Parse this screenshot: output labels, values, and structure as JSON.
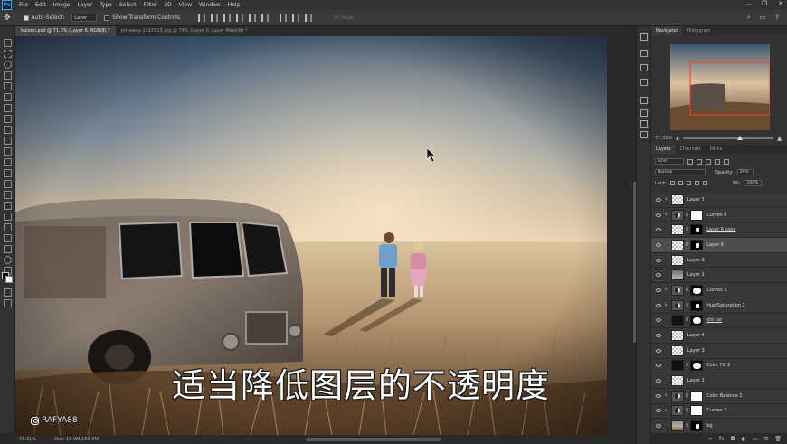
{
  "menubar": {
    "app_icon": "Ps",
    "items": [
      "File",
      "Edit",
      "Image",
      "Layer",
      "Type",
      "Select",
      "Filter",
      "3D",
      "View",
      "Window",
      "Help"
    ]
  },
  "options": {
    "auto_select_label": "Auto-Select:",
    "auto_select_value": "Layer",
    "transform_label": "Show Transform Controls",
    "mode_3d": "3D Mode:"
  },
  "tabs": [
    {
      "label": "baloon.psd @ 71.3% (Layer 6, RGB/8) *",
      "active": true
    },
    {
      "label": "pic-away-1315515.jpg @ 76% (Layer 0, Layer Mask/8) *",
      "active": false
    }
  ],
  "canvas": {
    "subtitle": "适当降低图层的不透明度",
    "watermark": "RAFYA88"
  },
  "status": {
    "zoom": "71.31%",
    "doc": "Doc: 15.9M/165.3M"
  },
  "navigator": {
    "tabs": [
      "Navigator",
      "Histogram"
    ],
    "zoom": "71.31%"
  },
  "layers_panel": {
    "tabs": [
      "Layers",
      "Channels",
      "Paths"
    ],
    "kind": "Kind",
    "blend_mode": "Normal",
    "opacity_label": "Opacity:",
    "opacity_value": "20%",
    "lock_label": "Lock:",
    "fill_label": "Fill:",
    "fill_value": "100%",
    "layers": [
      {
        "name": "Layer 7",
        "thumb": "checker",
        "mask": "",
        "clip": true
      },
      {
        "name": "Curves 4",
        "thumb": "adj",
        "mask": "white",
        "clip": true
      },
      {
        "name": "Layer 6 copy",
        "thumb": "checker",
        "mask": "black",
        "clip": false
      },
      {
        "name": "Layer 6",
        "thumb": "checker",
        "mask": "black",
        "clip": false
      },
      {
        "name": "Layer 3",
        "thumb": "checker",
        "mask": "",
        "clip": false
      },
      {
        "name": "Layer 2",
        "thumb": "gray",
        "mask": "",
        "clip": false
      },
      {
        "name": "Curves 3",
        "thumb": "adj",
        "mask": "blob",
        "clip": true
      },
      {
        "name": "Hue/Saturation 2",
        "thumb": "adj",
        "mask": "black",
        "clip": true
      },
      {
        "name": "old car",
        "thumb": "dark",
        "mask": "blob",
        "clip": false
      },
      {
        "name": "Layer 4",
        "thumb": "checker",
        "mask": "",
        "clip": false
      },
      {
        "name": "Layer 3",
        "thumb": "checker",
        "mask": "",
        "clip": false
      },
      {
        "name": "Color Fill 2",
        "thumb": "dark",
        "mask": "blob",
        "clip": false
      },
      {
        "name": "Layer 1",
        "thumb": "checker",
        "mask": "",
        "clip": false
      },
      {
        "name": "Color Balance 1",
        "thumb": "adj",
        "mask": "white",
        "clip": true
      },
      {
        "name": "Curves 2",
        "thumb": "adj",
        "mask": "white",
        "clip": true
      },
      {
        "name": "bg",
        "thumb": "photo",
        "mask": "black",
        "clip": false
      }
    ],
    "footer_icons": [
      "link-icon",
      "fx-icon",
      "mask-icon",
      "adjustment-icon",
      "group-icon",
      "new-layer-icon",
      "trash-icon"
    ]
  }
}
